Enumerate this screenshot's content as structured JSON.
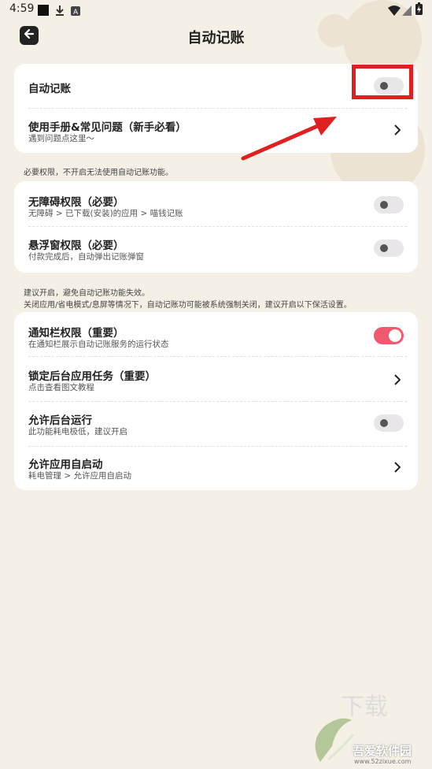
{
  "status_bar": {
    "time": "4:59",
    "icons": [
      "square-icon",
      "download-icon",
      "a-icon",
      "wifi-icon",
      "signal-icon",
      "battery-icon"
    ]
  },
  "header": {
    "title": "自动记账",
    "back_icon": "arrow-left-icon"
  },
  "card1": {
    "auto_record_label": "自动记账",
    "auto_record_on": false,
    "manual_title": "使用手册&常见问题（新手必看）",
    "manual_sub": "遇到问题点这里～"
  },
  "note1": "必要权限，不开启无法使用自动记账功能。",
  "card2": {
    "items": [
      {
        "title": "无障碍权限（必要）",
        "sub": "无障碍 > 已下载(安装)的应用 > 喵钱记账",
        "on": false
      },
      {
        "title": "悬浮窗权限（必要）",
        "sub": "付款完成后，自动弹出记账弹窗",
        "on": false
      }
    ]
  },
  "note2": {
    "line1": "建议开启，避免自动记账功能失效。",
    "line2": "关闭应用/省电模式/息屏等情况下，自动记账功可能被系统强制关闭，建议开启以下保活设置。"
  },
  "card3": {
    "notify_title": "通知栏权限（重要）",
    "notify_sub": "在通知栏展示自动记账服务的运行状态",
    "notify_on": true,
    "lock_title": "锁定后台应用任务（重要）",
    "lock_sub": "点击查看图文教程",
    "bg_title": "允许后台运行",
    "bg_sub": "此功能耗电极低，建议开启",
    "bg_on": false,
    "autostart_title": "允许应用自启动",
    "autostart_sub": "耗电管理 > 允许应用自启动"
  },
  "watermark": {
    "main": "吾爱软件园",
    "url": "www.52zixue.com",
    "big": "下载"
  },
  "colors": {
    "background": "#f5f0e6",
    "toggle_on": "#f05a6e",
    "highlight": "#e02020"
  }
}
